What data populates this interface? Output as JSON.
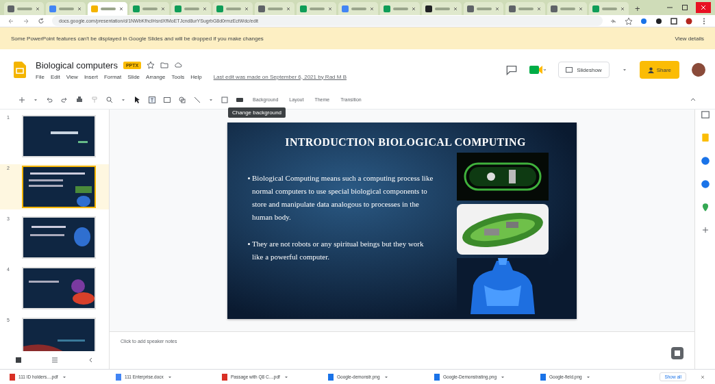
{
  "browser": {
    "tabs": [
      {
        "selected": false,
        "color": "#5f6368"
      },
      {
        "selected": false,
        "color": "#4285f4"
      },
      {
        "selected": true,
        "color": "#f4b400"
      },
      {
        "selected": false,
        "color": "#0f9d58"
      },
      {
        "selected": false,
        "color": "#0f9d58"
      },
      {
        "selected": false,
        "color": "#0f9d58"
      },
      {
        "selected": false,
        "color": "#5f6368"
      },
      {
        "selected": false,
        "color": "#0f9d58"
      },
      {
        "selected": false,
        "color": "#4285f4"
      },
      {
        "selected": false,
        "color": "#0f9d58"
      },
      {
        "selected": false,
        "color": "#202124"
      },
      {
        "selected": false,
        "color": "#5f6368"
      },
      {
        "selected": false,
        "color": "#5f6368"
      },
      {
        "selected": false,
        "color": "#5f6368"
      },
      {
        "selected": false,
        "color": "#0f9d58"
      }
    ],
    "new_tab": "+",
    "address": "docs.google.com/presentation/d/1NWbKfhcIHsrdXfMoETJcnd8urYSugrbG8d0rmzEctWdc/edit"
  },
  "banner": {
    "message": "Some PowerPoint features can't be displayed in Google Slides and will be dropped if you make changes",
    "action": "View details"
  },
  "document": {
    "title": "Biological computers",
    "badge": "PPTX",
    "menu": [
      "File",
      "Edit",
      "View",
      "Insert",
      "Format",
      "Slide",
      "Arrange",
      "Tools",
      "Help"
    ],
    "last_edit": "Last edit was made on September 6, 2021 by Rad M B",
    "slideshow": "Slideshow",
    "share": "Share"
  },
  "toolbar": {
    "buttons": [
      "Background",
      "Layout",
      "Theme",
      "Transition"
    ],
    "tooltip": "Change background"
  },
  "slides": [
    {
      "number": "1",
      "selected": false,
      "kind": "title"
    },
    {
      "number": "2",
      "selected": true,
      "kind": "pictures"
    },
    {
      "number": "3",
      "selected": false,
      "kind": "body"
    },
    {
      "number": "4",
      "selected": false,
      "kind": "molecule"
    },
    {
      "number": "5",
      "selected": false,
      "kind": "wave"
    }
  ],
  "slide": {
    "title": "INTRODUCTION BIOLOGICAL COMPUTING",
    "bullets": [
      "Biological Computing means such a computing process like normal computers to use special biological components to store and manipulate data analogous to processes in the human body.",
      "They are not robots or any spiritual beings but they work like a powerful computer."
    ],
    "pictures": [
      {
        "kind": "picture"
      },
      {
        "kind": "picture"
      },
      {
        "kind": "picture"
      }
    ]
  },
  "notes": {
    "placeholder": "Click to add speaker notes"
  },
  "downloads": {
    "files": [
      {
        "name": "111 ID holders....pdf",
        "color": "#d93025"
      },
      {
        "name": "111 Enterprise.docx",
        "color": "#4285f4"
      },
      {
        "name": "Passage with Q8 C....pdf",
        "color": "#d93025"
      },
      {
        "name": "Google-demonstr.png",
        "color": "#1a73e8"
      },
      {
        "name": "Google-Demonstrating.png",
        "color": "#1a73e8"
      },
      {
        "name": "Google-field.png",
        "color": "#1a73e8"
      }
    ],
    "show_all": "Show all"
  }
}
